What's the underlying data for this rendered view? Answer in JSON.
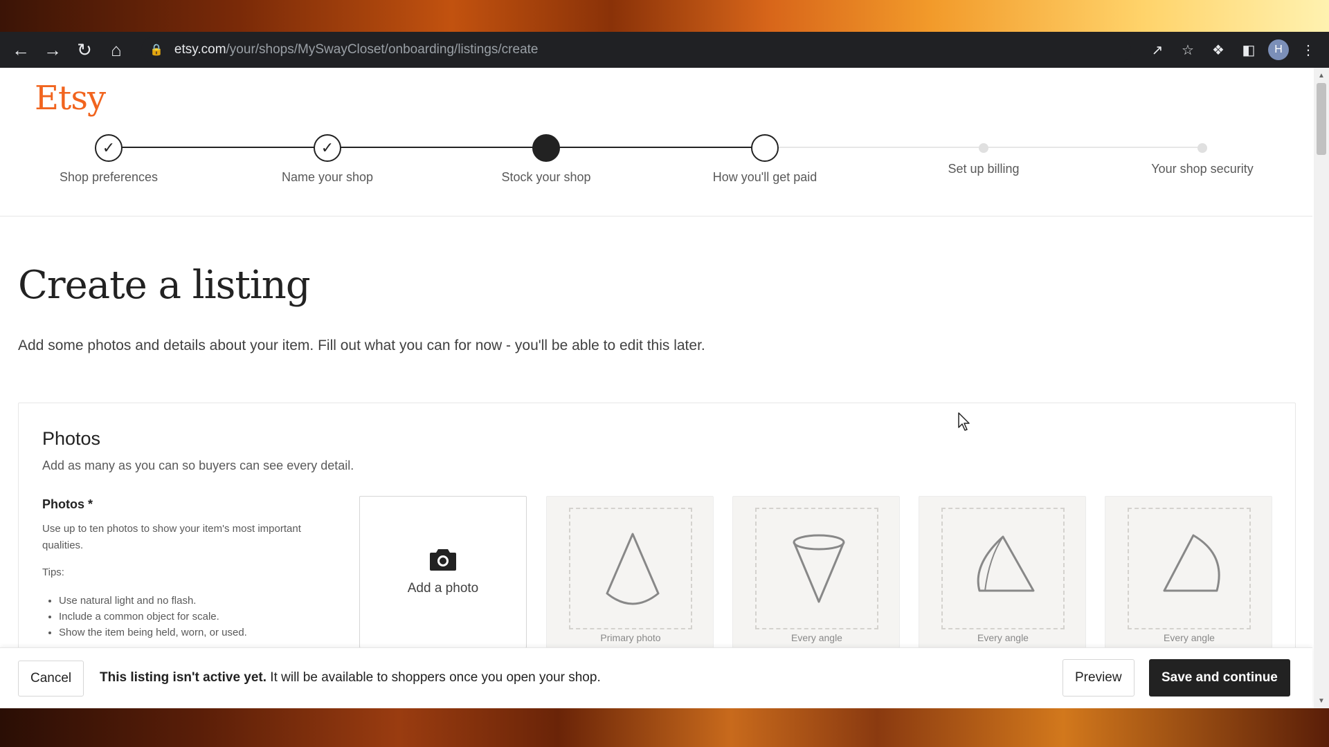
{
  "browser": {
    "url_host": "etsy.com",
    "url_path": "/your/shops/MySwayCloset/onboarding/listings/create",
    "profile_initial": "H"
  },
  "logo": "Etsy",
  "stepper": {
    "steps": [
      {
        "label": "Shop preferences",
        "state": "done"
      },
      {
        "label": "Name your shop",
        "state": "done"
      },
      {
        "label": "Stock your shop",
        "state": "current"
      },
      {
        "label": "How you'll get paid",
        "state": "next"
      },
      {
        "label": "Set up billing",
        "state": "upcoming"
      },
      {
        "label": "Your shop security",
        "state": "upcoming"
      }
    ]
  },
  "page": {
    "title": "Create a listing",
    "subtitle": "Add some photos and details about your item. Fill out what you can for now - you'll be able to edit this later."
  },
  "photos": {
    "heading": "Photos",
    "description": "Add as many as you can so buyers can see every detail.",
    "field_label": "Photos *",
    "help": "Use up to ten photos to show your item's most important qualities.",
    "tips_label": "Tips:",
    "tips": [
      "Use natural light and no flash.",
      "Include a common object for scale.",
      "Show the item being held, worn, or used."
    ],
    "add_photo_label": "Add a photo",
    "placeholders": [
      {
        "caption": "Primary photo"
      },
      {
        "caption": "Every angle"
      },
      {
        "caption": "Every angle"
      },
      {
        "caption": "Every angle"
      }
    ]
  },
  "action_bar": {
    "cancel_label": "Cancel",
    "notice_bold": "This listing isn't active yet.",
    "notice_rest": " It will be available to shoppers once you open your shop.",
    "preview_label": "Preview",
    "save_label": "Save and continue"
  },
  "colors": {
    "brand": "#f1641e",
    "primary_button": "#222222"
  }
}
